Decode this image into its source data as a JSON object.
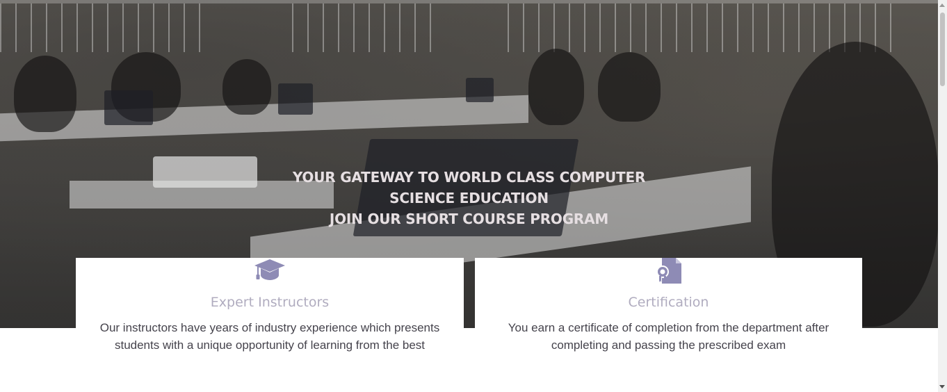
{
  "hero": {
    "title_line1": "YOUR GATEWAY TO WORLD CLASS COMPUTER SCIENCE EDUCATION",
    "title_line2": "JOIN OUR SHORT COURSE PROGRAM",
    "background_image": "classroom-students-laptops"
  },
  "features": [
    {
      "icon": "graduation-cap-icon",
      "title": "Expert Instructors",
      "text": "Our instructors have years of industry experience which presents students with a unique opportunity of learning from the best"
    },
    {
      "icon": "certificate-document-icon",
      "title": "Certification",
      "text": "You earn a certificate of completion from the department after completing and passing the prescribed exam"
    }
  ],
  "colors": {
    "icon": "#8e8bb5",
    "card_title": "#b0acbf",
    "card_text": "#45434c",
    "hero_text": "#e6dfe2"
  }
}
